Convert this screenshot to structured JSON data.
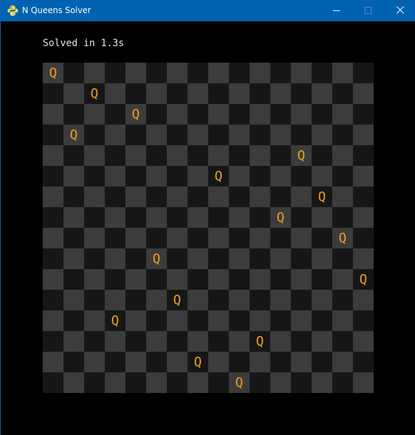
{
  "window": {
    "title": "N Queens Solver",
    "icon": "python-icon",
    "controls": [
      "minimize-icon",
      "maximize-icon",
      "close-icon"
    ]
  },
  "status": {
    "text": "Solved in 1.3s"
  },
  "board": {
    "size": 16,
    "queen_symbol": "Q",
    "queen_columns_by_row": [
      0,
      2,
      4,
      1,
      12,
      8,
      13,
      11,
      14,
      5,
      15,
      6,
      3,
      10,
      7,
      9
    ],
    "colors": {
      "light_square": "#3c3c3c",
      "dark_square": "#161616",
      "queen": "#f0a020",
      "titlebar": "#0063b1"
    }
  }
}
